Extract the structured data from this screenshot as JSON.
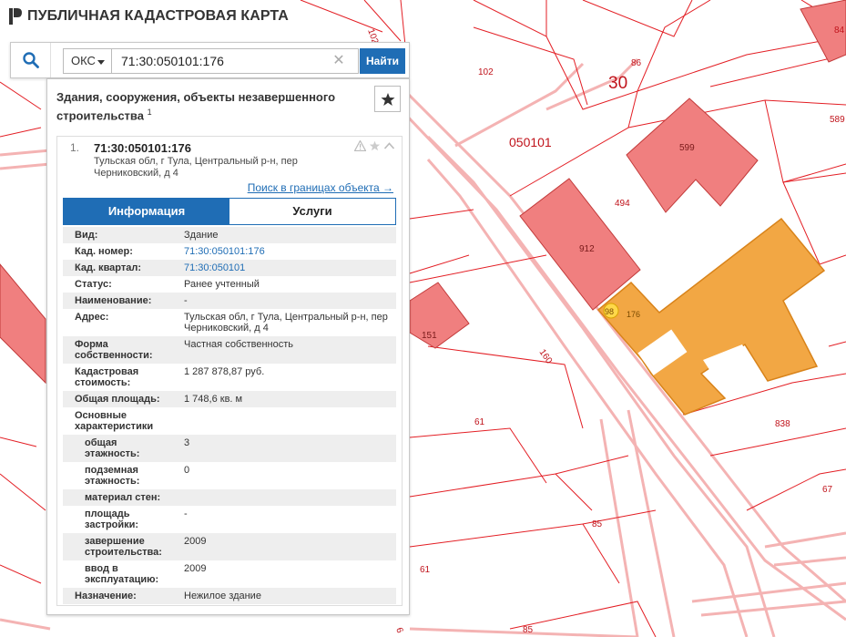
{
  "app": {
    "title": "ПУБЛИЧНАЯ КАДАСТРОВАЯ КАРТА"
  },
  "search": {
    "type_label": "ОКС",
    "query": "71:30:050101:176",
    "find_label": "Найти"
  },
  "panel": {
    "title": "Здания, сооружения, объекты незавершенного строительства",
    "title_count": "1"
  },
  "result": {
    "index": "1.",
    "number": "71:30:050101:176",
    "address": "Тульская обл, г Тула, Центральный р-н, пер Черниковский, д 4",
    "search_within_label": "Поиск в границах объекта →"
  },
  "tabs": {
    "info": "Информация",
    "services": "Услуги"
  },
  "attributes": [
    {
      "label": "Вид:",
      "value": "Здание"
    },
    {
      "label": "Кад. номер:",
      "value": "71:30:050101:176"
    },
    {
      "label": "Кад. квартал:",
      "value": "71:30:050101"
    },
    {
      "label": "Статус:",
      "value": "Ранее учтенный"
    },
    {
      "label": "Наименование:",
      "value": "-"
    },
    {
      "label": "Адрес:",
      "value": "Тульская обл, г Тула, Центральный р-н, пер Черниковский, д 4"
    },
    {
      "label": "Форма собственности:",
      "value": "Частная собственность"
    },
    {
      "label": "Кадастровая стоимость:",
      "value": "1 287 878,87 руб."
    },
    {
      "label": "Общая площадь:",
      "value": "1 748,6 кв. м"
    },
    {
      "label": "Основные характеристики",
      "value": ""
    },
    {
      "label": "общая этажность:",
      "value": "3"
    },
    {
      "label": "подземная этажность:",
      "value": "0"
    },
    {
      "label": "материал стен:",
      "value": ""
    },
    {
      "label": "площадь застройки:",
      "value": "-"
    },
    {
      "label": "завершение строительства:",
      "value": "2009"
    },
    {
      "label": "ввод в эксплуатацию:",
      "value": "2009"
    },
    {
      "label": "Назначение:",
      "value": "Нежилое здание"
    }
  ],
  "map": {
    "quarter_label": "050101",
    "district_label": "30",
    "parcel_labels": [
      "102",
      "102",
      "86",
      "84",
      "589",
      "599",
      "494",
      "912",
      "98",
      "176",
      "160",
      "151",
      "838",
      "61",
      "67",
      "85",
      "61",
      "85",
      "6"
    ]
  },
  "colors": {
    "accent": "#1f6db5",
    "building": "#f07f7f",
    "selected": "#f2a744",
    "parcel_line": "#e31e24",
    "road": "#f4b3b3"
  }
}
